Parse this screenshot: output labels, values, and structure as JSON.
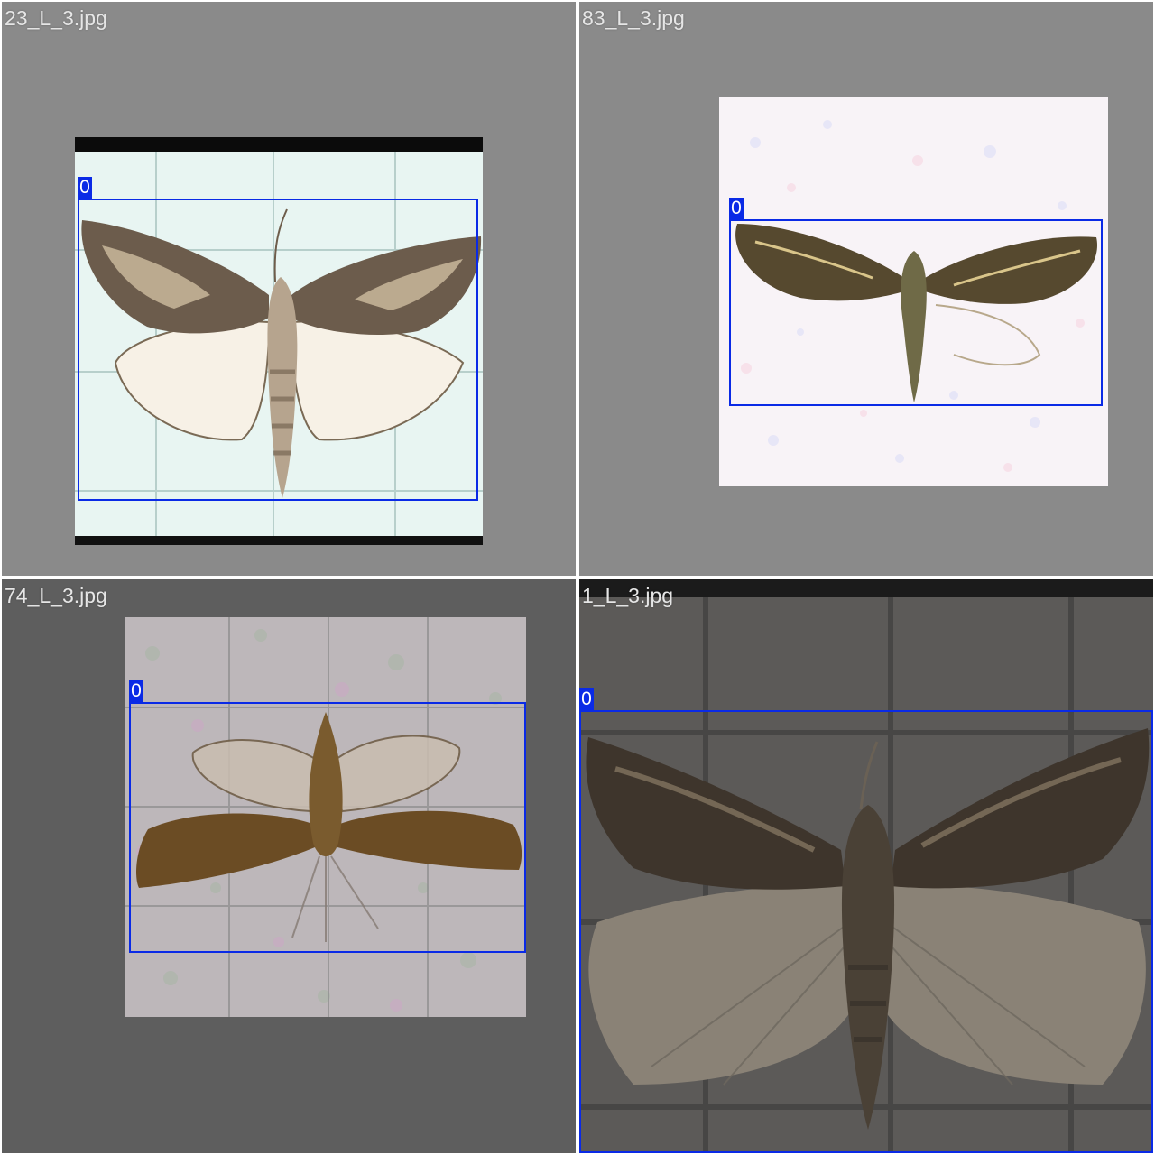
{
  "tiles": [
    {
      "filename": "23_L_3.jpg",
      "box_label": "0"
    },
    {
      "filename": "83_L_3.jpg",
      "box_label": "0"
    },
    {
      "filename": "74_L_3.jpg",
      "box_label": "0"
    },
    {
      "filename": "1_L_3.jpg",
      "box_label": "0"
    }
  ],
  "colors": {
    "bbox": "#0a2ae6",
    "tile_background_light": "#8a8a8a",
    "tile_background_dark": "#5e5e5e"
  }
}
